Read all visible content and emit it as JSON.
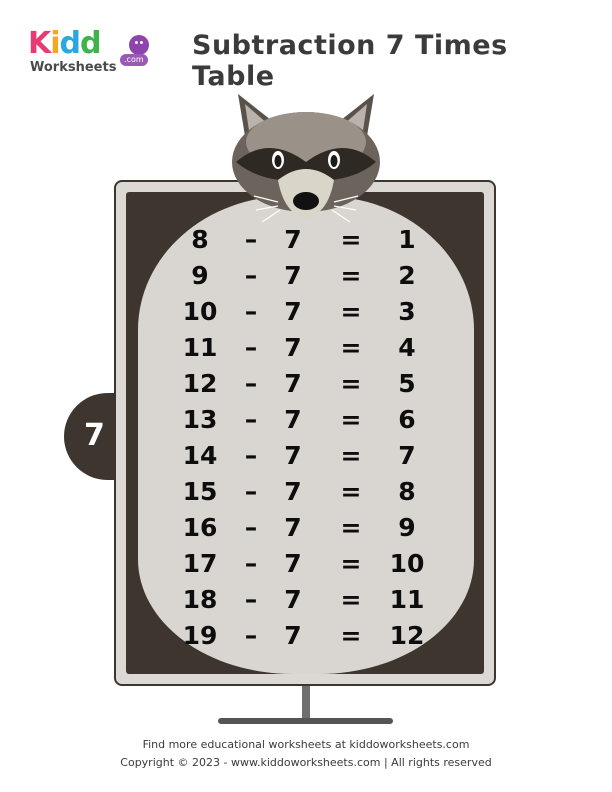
{
  "logo": {
    "brand": [
      "K",
      "i",
      "d",
      "d"
    ],
    "sub": "Worksheets",
    "com": ".com"
  },
  "title": "Subtraction 7 Times Table",
  "tab_label": "7",
  "rows": [
    {
      "a": "8",
      "op": "–",
      "b": "7",
      "eq": "=",
      "r": "1"
    },
    {
      "a": "9",
      "op": "–",
      "b": "7",
      "eq": "=",
      "r": "2"
    },
    {
      "a": "10",
      "op": "–",
      "b": "7",
      "eq": "=",
      "r": "3"
    },
    {
      "a": "11",
      "op": "–",
      "b": "7",
      "eq": "=",
      "r": "4"
    },
    {
      "a": "12",
      "op": "–",
      "b": "7",
      "eq": "=",
      "r": "5"
    },
    {
      "a": "13",
      "op": "–",
      "b": "7",
      "eq": "=",
      "r": "6"
    },
    {
      "a": "14",
      "op": "–",
      "b": "7",
      "eq": "=",
      "r": "7"
    },
    {
      "a": "15",
      "op": "–",
      "b": "7",
      "eq": "=",
      "r": "8"
    },
    {
      "a": "16",
      "op": "–",
      "b": "7",
      "eq": "=",
      "r": "9"
    },
    {
      "a": "17",
      "op": "–",
      "b": "7",
      "eq": "=",
      "r": "10"
    },
    {
      "a": "18",
      "op": "–",
      "b": "7",
      "eq": "=",
      "r": "11"
    },
    {
      "a": "19",
      "op": "–",
      "b": "7",
      "eq": "=",
      "r": "12"
    }
  ],
  "footer": {
    "line1": "Find more educational worksheets at kiddoworksheets.com",
    "line2": "Copyright © 2023 - www.kiddoworksheets.com  |  All rights reserved"
  },
  "colors": {
    "board": "#3d352e",
    "belly": "#d9d5d0",
    "text": "#0d0d0d"
  },
  "icons": {
    "mascot": "raccoon-icon"
  }
}
